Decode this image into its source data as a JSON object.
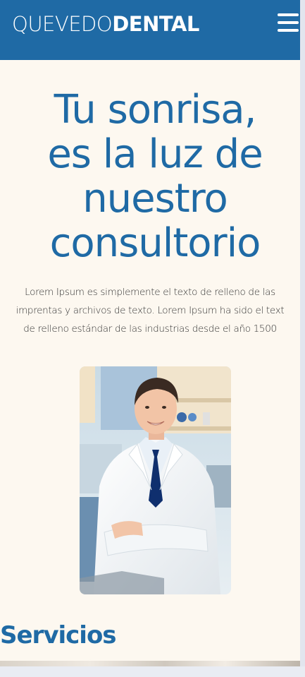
{
  "header": {
    "logo_light": "QUEVEDO",
    "logo_bold": "DENTAL",
    "menu_icon": "hamburger-menu-icon",
    "background_color": "#1f6aa5"
  },
  "hero": {
    "title_lines": [
      "Tu sonrisa,",
      "es la luz de",
      "nuestro",
      "consultorio"
    ],
    "text_lines": [
      "Lorem Ipsum es simplemente el texto de relleno de las",
      "imprentas y archivos de texto. Lorem Ipsum ha sido el text",
      "de relleno estándar de las industrias desde el año 1500"
    ],
    "image_subject": "dentist-portrait"
  },
  "services": {
    "title": "Servicios"
  },
  "colors": {
    "accent": "#1f6aa5",
    "page_background": "#fdf8f0",
    "body_text": "#333333"
  }
}
